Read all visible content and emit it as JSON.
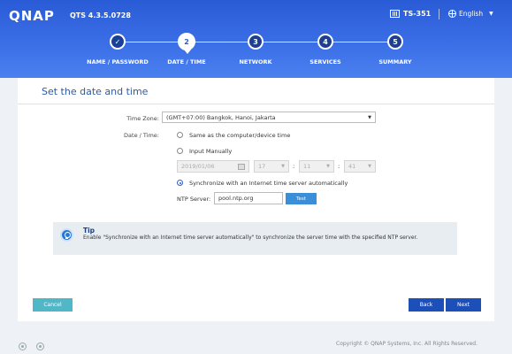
{
  "header": {
    "logo": "QNAP",
    "version": "QTS 4.3.5.0728",
    "device": "TS-351",
    "language": "English"
  },
  "steps": [
    {
      "number": "✓",
      "label": "NAME / PASSWORD",
      "state": "done"
    },
    {
      "number": "2",
      "label": "DATE / TIME",
      "state": "active"
    },
    {
      "number": "3",
      "label": "NETWORK",
      "state": "pending"
    },
    {
      "number": "4",
      "label": "SERVICES",
      "state": "pending"
    },
    {
      "number": "5",
      "label": "SUMMARY",
      "state": "pending"
    }
  ],
  "panel": {
    "title": "Set the date and time",
    "timezone_label": "Time Zone:",
    "timezone_value": "(GMT+07:00) Bangkok, Hanoi, Jakarta",
    "datetime_label": "Date / Time:",
    "option_same": "Same as the computer/device time",
    "option_manual": "Input Manually",
    "date_value": "2019/01/06",
    "hour": "17",
    "minute": "11",
    "second": "41",
    "option_sync": "Synchronize with an Internet time server automatically",
    "selected_option": "sync",
    "ntp_label": "NTP Server:",
    "ntp_value": "pool.ntp.org",
    "test_label": "Test"
  },
  "tip": {
    "title": "Tip",
    "text": "Enable \"Synchronize with an Internet time server automatically\" to synchronize the server time with the specified NTP server."
  },
  "buttons": {
    "cancel": "Cancel",
    "back": "Back",
    "next": "Next"
  },
  "footer": {
    "copyright": "Copyright © QNAP Systems, Inc. All Rights Reserved."
  }
}
